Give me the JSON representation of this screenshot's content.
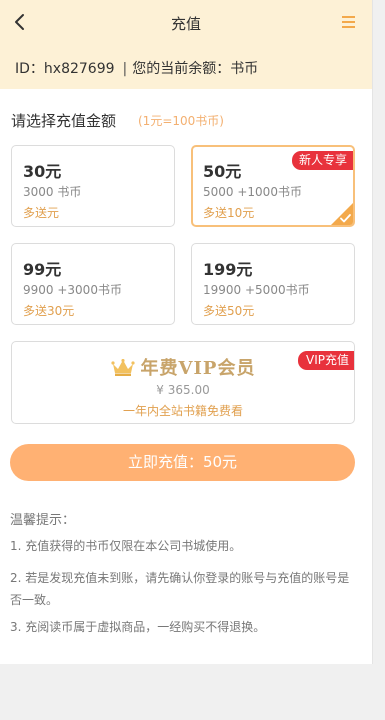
{
  "header": {
    "title": "充值",
    "back_icon": "chevron-left-icon",
    "menu_icon": "hamburger-menu-icon",
    "accent": "#f3a94b",
    "background": "#fdf1d6"
  },
  "account": {
    "id_label": "ID：",
    "id_value": "hx827699",
    "separator": "|",
    "balance_label": "您的当前余额：",
    "balance_value": "书币"
  },
  "recharge": {
    "section_title": "请选择充值金额",
    "rate_note": "(1元=100书币)",
    "options": [
      {
        "price": "30元",
        "coins": "3000 书币",
        "bonus": "多送元",
        "tag": "",
        "selected": false
      },
      {
        "price": "50元",
        "coins": "5000 +1000书币",
        "bonus": "多送10元",
        "tag": "新人专享",
        "selected": true
      },
      {
        "price": "99元",
        "coins": "9900 +3000书币",
        "bonus": "多送30元",
        "tag": "",
        "selected": false
      },
      {
        "price": "199元",
        "coins": "19900 +5000书币",
        "bonus": "多送50元",
        "tag": "",
        "selected": false
      }
    ],
    "vip": {
      "icon": "crown-icon",
      "title": "年费VIP会员",
      "price": "¥ 365.00",
      "desc": "一年内全站书籍免费看",
      "tag": "VIP充值"
    },
    "pay_button": "立即充值：50元"
  },
  "tips": {
    "title": "温馨提示：",
    "items": [
      "1. 充值获得的书币仅限在本公司书城使用。",
      "2. 若是发现充值未到账，请先确认你登录的账号与充值的账号是否一致。",
      "3. 充阅读币属于虚拟商品，一经购买不得退换。"
    ]
  },
  "colors": {
    "tag_red": "#e8323c",
    "bonus_orange": "#e1a04f",
    "button_orange": "#ffb173",
    "vip_gold": "#c8a46a",
    "selected_border": "#f8c07a"
  }
}
